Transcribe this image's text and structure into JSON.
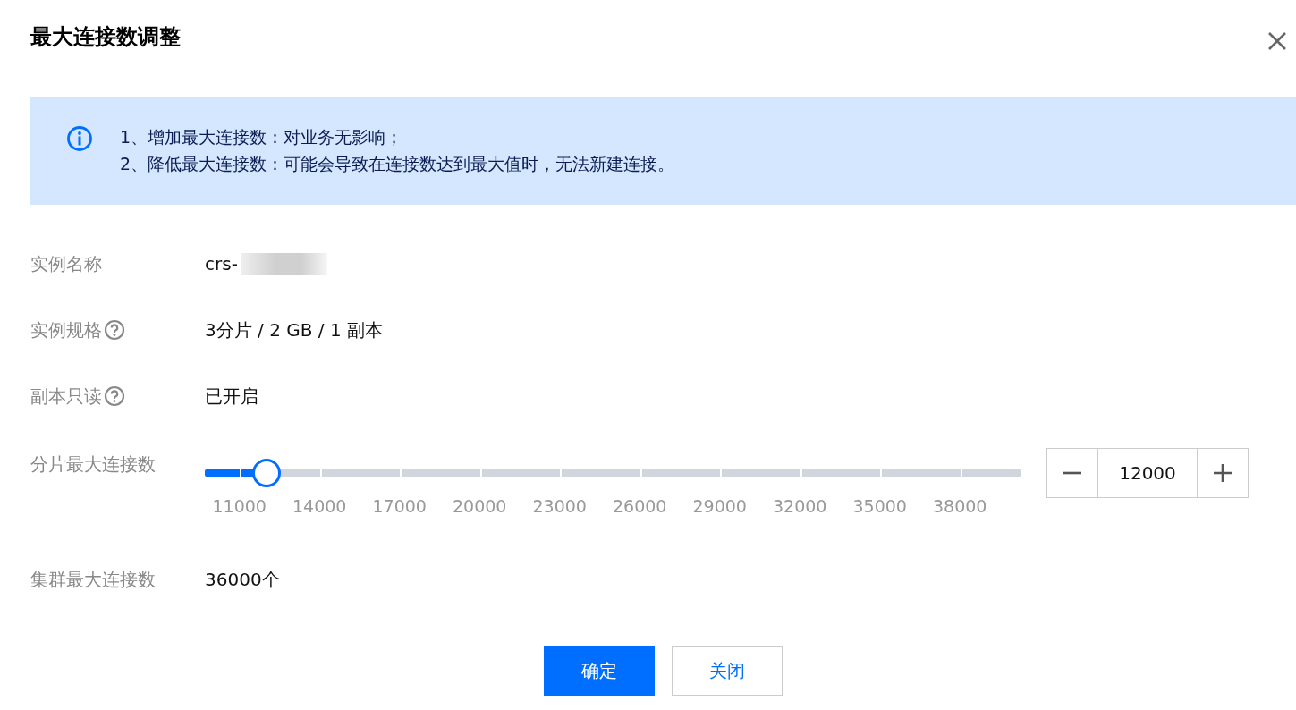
{
  "dialog": {
    "title": "最大连接数调整"
  },
  "notice": {
    "lines": [
      "1、增加最大连接数：对业务无影响；",
      "2、降低最大连接数：可能会导致在连接数达到最大值时，无法新建连接。"
    ]
  },
  "fields": [
    {
      "kind": "text",
      "label": "实例名称",
      "value": "crs-",
      "help": false,
      "redacted": true
    },
    {
      "kind": "text",
      "label": "实例规格",
      "value": "3分片 / 2 GB / 1 副本",
      "help": true,
      "redacted": false
    },
    {
      "kind": "text",
      "label": "副本只读",
      "value": "已开启",
      "help": true,
      "redacted": false
    },
    {
      "kind": "slider",
      "label": "分片最大连接数",
      "level": 0.076,
      "ticks": [
        "11000",
        "14000",
        "17000",
        "20000",
        "23000",
        "26000",
        "29000",
        "32000",
        "35000",
        "38000"
      ],
      "value": "12000"
    },
    {
      "kind": "text",
      "label": "集群最大连接数",
      "value": "36000个",
      "help": false,
      "redacted": false
    }
  ],
  "buttons": [
    {
      "label": "确定",
      "primary": true
    },
    {
      "label": "关闭",
      "primary": false
    }
  ]
}
